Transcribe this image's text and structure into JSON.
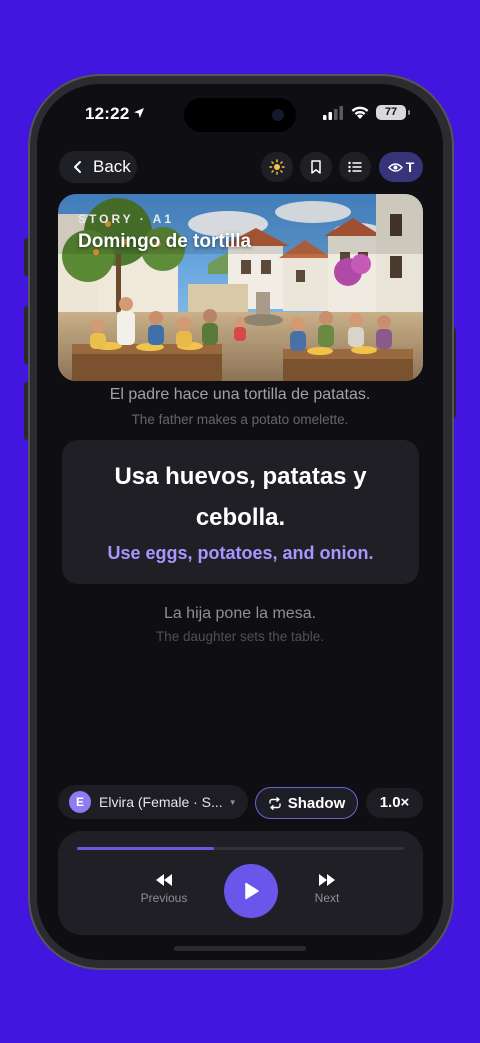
{
  "status_bar": {
    "time": "12:22",
    "battery": "77"
  },
  "header": {
    "back_label": "Back",
    "translate_toggle_label": "T"
  },
  "story": {
    "kicker": "STORY · A1",
    "title": "Domingo de tortilla"
  },
  "sentences": {
    "previous": {
      "es": "El padre hace una tortilla de patatas.",
      "en": "The father makes a potato omelette."
    },
    "current": {
      "es": "Usa huevos, patatas y cebolla.",
      "en": "Use eggs, potatoes, and onion."
    },
    "next": {
      "es": "La hija pone la mesa.",
      "en": "The daughter sets the table."
    }
  },
  "voice": {
    "avatar_letter": "E",
    "name": "Elvira (Female · S..."
  },
  "shadow_label": "Shadow",
  "speed_label": "1.0×",
  "player": {
    "progress": 0.42,
    "previous_label": "Previous",
    "next_label": "Next"
  },
  "colors": {
    "accent": "#6a56ea",
    "accent_text": "#a796ff",
    "background": "#4316e0"
  }
}
